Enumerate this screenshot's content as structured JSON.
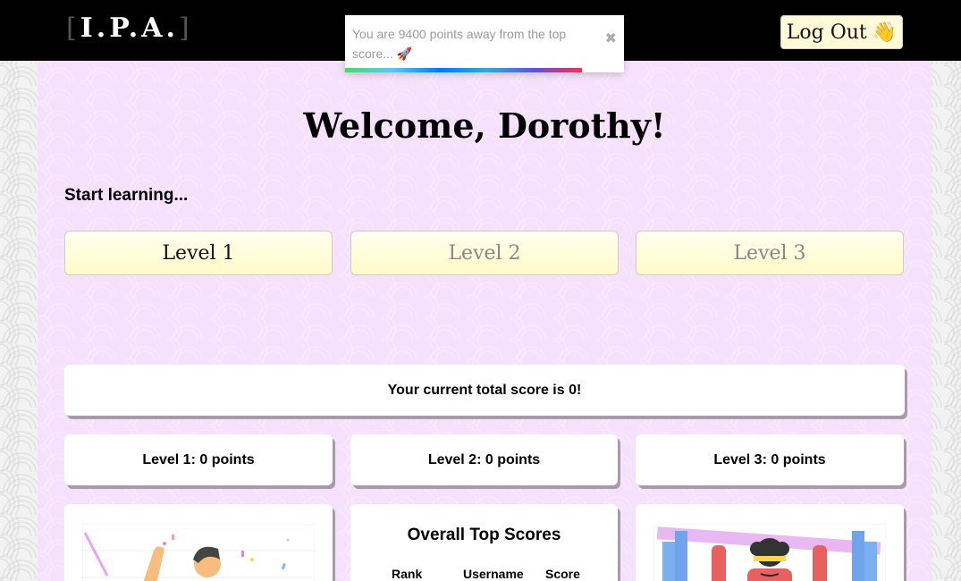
{
  "header": {
    "logo": {
      "open": "[",
      "text": "I.P.A.",
      "close": "]"
    },
    "logout_label": "Log Out",
    "logout_emoji": "👋"
  },
  "toast": {
    "message": "You are 9400 points away from the top score... 🚀",
    "close_glyph": "✖",
    "progress": 0.85
  },
  "main": {
    "welcome": "Welcome, Dorothy!",
    "start_label": "Start learning...",
    "levels": [
      {
        "label": "Level 1",
        "state": "active"
      },
      {
        "label": "Level 2",
        "state": "locked"
      },
      {
        "label": "Level 3",
        "state": "locked"
      }
    ],
    "total_score": "Your current total score is 0!",
    "level_scores": [
      "Level 1: 0 points",
      "Level 2: 0 points",
      "Level 3: 0 points"
    ],
    "top_scores": {
      "title": "Overall Top Scores",
      "columns": [
        "Rank",
        "Username",
        "Score"
      ]
    }
  },
  "colors": {
    "topbar": "#000000",
    "main_bg": "#f5e1fb",
    "level_button": "#fffbc8",
    "card_shadow": "#a89aa8"
  }
}
